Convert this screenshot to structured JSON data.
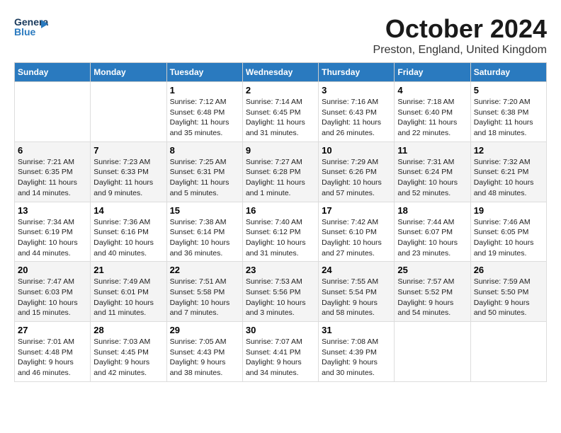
{
  "header": {
    "logo_line1": "General",
    "logo_line2": "Blue",
    "month_title": "October 2024",
    "location": "Preston, England, United Kingdom"
  },
  "days_of_week": [
    "Sunday",
    "Monday",
    "Tuesday",
    "Wednesday",
    "Thursday",
    "Friday",
    "Saturday"
  ],
  "weeks": [
    [
      {
        "day": "",
        "sunrise": "",
        "sunset": "",
        "daylight": ""
      },
      {
        "day": "",
        "sunrise": "",
        "sunset": "",
        "daylight": ""
      },
      {
        "day": "1",
        "sunrise": "Sunrise: 7:12 AM",
        "sunset": "Sunset: 6:48 PM",
        "daylight": "Daylight: 11 hours and 35 minutes."
      },
      {
        "day": "2",
        "sunrise": "Sunrise: 7:14 AM",
        "sunset": "Sunset: 6:45 PM",
        "daylight": "Daylight: 11 hours and 31 minutes."
      },
      {
        "day": "3",
        "sunrise": "Sunrise: 7:16 AM",
        "sunset": "Sunset: 6:43 PM",
        "daylight": "Daylight: 11 hours and 26 minutes."
      },
      {
        "day": "4",
        "sunrise": "Sunrise: 7:18 AM",
        "sunset": "Sunset: 6:40 PM",
        "daylight": "Daylight: 11 hours and 22 minutes."
      },
      {
        "day": "5",
        "sunrise": "Sunrise: 7:20 AM",
        "sunset": "Sunset: 6:38 PM",
        "daylight": "Daylight: 11 hours and 18 minutes."
      }
    ],
    [
      {
        "day": "6",
        "sunrise": "Sunrise: 7:21 AM",
        "sunset": "Sunset: 6:35 PM",
        "daylight": "Daylight: 11 hours and 14 minutes."
      },
      {
        "day": "7",
        "sunrise": "Sunrise: 7:23 AM",
        "sunset": "Sunset: 6:33 PM",
        "daylight": "Daylight: 11 hours and 9 minutes."
      },
      {
        "day": "8",
        "sunrise": "Sunrise: 7:25 AM",
        "sunset": "Sunset: 6:31 PM",
        "daylight": "Daylight: 11 hours and 5 minutes."
      },
      {
        "day": "9",
        "sunrise": "Sunrise: 7:27 AM",
        "sunset": "Sunset: 6:28 PM",
        "daylight": "Daylight: 11 hours and 1 minute."
      },
      {
        "day": "10",
        "sunrise": "Sunrise: 7:29 AM",
        "sunset": "Sunset: 6:26 PM",
        "daylight": "Daylight: 10 hours and 57 minutes."
      },
      {
        "day": "11",
        "sunrise": "Sunrise: 7:31 AM",
        "sunset": "Sunset: 6:24 PM",
        "daylight": "Daylight: 10 hours and 52 minutes."
      },
      {
        "day": "12",
        "sunrise": "Sunrise: 7:32 AM",
        "sunset": "Sunset: 6:21 PM",
        "daylight": "Daylight: 10 hours and 48 minutes."
      }
    ],
    [
      {
        "day": "13",
        "sunrise": "Sunrise: 7:34 AM",
        "sunset": "Sunset: 6:19 PM",
        "daylight": "Daylight: 10 hours and 44 minutes."
      },
      {
        "day": "14",
        "sunrise": "Sunrise: 7:36 AM",
        "sunset": "Sunset: 6:16 PM",
        "daylight": "Daylight: 10 hours and 40 minutes."
      },
      {
        "day": "15",
        "sunrise": "Sunrise: 7:38 AM",
        "sunset": "Sunset: 6:14 PM",
        "daylight": "Daylight: 10 hours and 36 minutes."
      },
      {
        "day": "16",
        "sunrise": "Sunrise: 7:40 AM",
        "sunset": "Sunset: 6:12 PM",
        "daylight": "Daylight: 10 hours and 31 minutes."
      },
      {
        "day": "17",
        "sunrise": "Sunrise: 7:42 AM",
        "sunset": "Sunset: 6:10 PM",
        "daylight": "Daylight: 10 hours and 27 minutes."
      },
      {
        "day": "18",
        "sunrise": "Sunrise: 7:44 AM",
        "sunset": "Sunset: 6:07 PM",
        "daylight": "Daylight: 10 hours and 23 minutes."
      },
      {
        "day": "19",
        "sunrise": "Sunrise: 7:46 AM",
        "sunset": "Sunset: 6:05 PM",
        "daylight": "Daylight: 10 hours and 19 minutes."
      }
    ],
    [
      {
        "day": "20",
        "sunrise": "Sunrise: 7:47 AM",
        "sunset": "Sunset: 6:03 PM",
        "daylight": "Daylight: 10 hours and 15 minutes."
      },
      {
        "day": "21",
        "sunrise": "Sunrise: 7:49 AM",
        "sunset": "Sunset: 6:01 PM",
        "daylight": "Daylight: 10 hours and 11 minutes."
      },
      {
        "day": "22",
        "sunrise": "Sunrise: 7:51 AM",
        "sunset": "Sunset: 5:58 PM",
        "daylight": "Daylight: 10 hours and 7 minutes."
      },
      {
        "day": "23",
        "sunrise": "Sunrise: 7:53 AM",
        "sunset": "Sunset: 5:56 PM",
        "daylight": "Daylight: 10 hours and 3 minutes."
      },
      {
        "day": "24",
        "sunrise": "Sunrise: 7:55 AM",
        "sunset": "Sunset: 5:54 PM",
        "daylight": "Daylight: 9 hours and 58 minutes."
      },
      {
        "day": "25",
        "sunrise": "Sunrise: 7:57 AM",
        "sunset": "Sunset: 5:52 PM",
        "daylight": "Daylight: 9 hours and 54 minutes."
      },
      {
        "day": "26",
        "sunrise": "Sunrise: 7:59 AM",
        "sunset": "Sunset: 5:50 PM",
        "daylight": "Daylight: 9 hours and 50 minutes."
      }
    ],
    [
      {
        "day": "27",
        "sunrise": "Sunrise: 7:01 AM",
        "sunset": "Sunset: 4:48 PM",
        "daylight": "Daylight: 9 hours and 46 minutes."
      },
      {
        "day": "28",
        "sunrise": "Sunrise: 7:03 AM",
        "sunset": "Sunset: 4:45 PM",
        "daylight": "Daylight: 9 hours and 42 minutes."
      },
      {
        "day": "29",
        "sunrise": "Sunrise: 7:05 AM",
        "sunset": "Sunset: 4:43 PM",
        "daylight": "Daylight: 9 hours and 38 minutes."
      },
      {
        "day": "30",
        "sunrise": "Sunrise: 7:07 AM",
        "sunset": "Sunset: 4:41 PM",
        "daylight": "Daylight: 9 hours and 34 minutes."
      },
      {
        "day": "31",
        "sunrise": "Sunrise: 7:08 AM",
        "sunset": "Sunset: 4:39 PM",
        "daylight": "Daylight: 9 hours and 30 minutes."
      },
      {
        "day": "",
        "sunrise": "",
        "sunset": "",
        "daylight": ""
      },
      {
        "day": "",
        "sunrise": "",
        "sunset": "",
        "daylight": ""
      }
    ]
  ]
}
